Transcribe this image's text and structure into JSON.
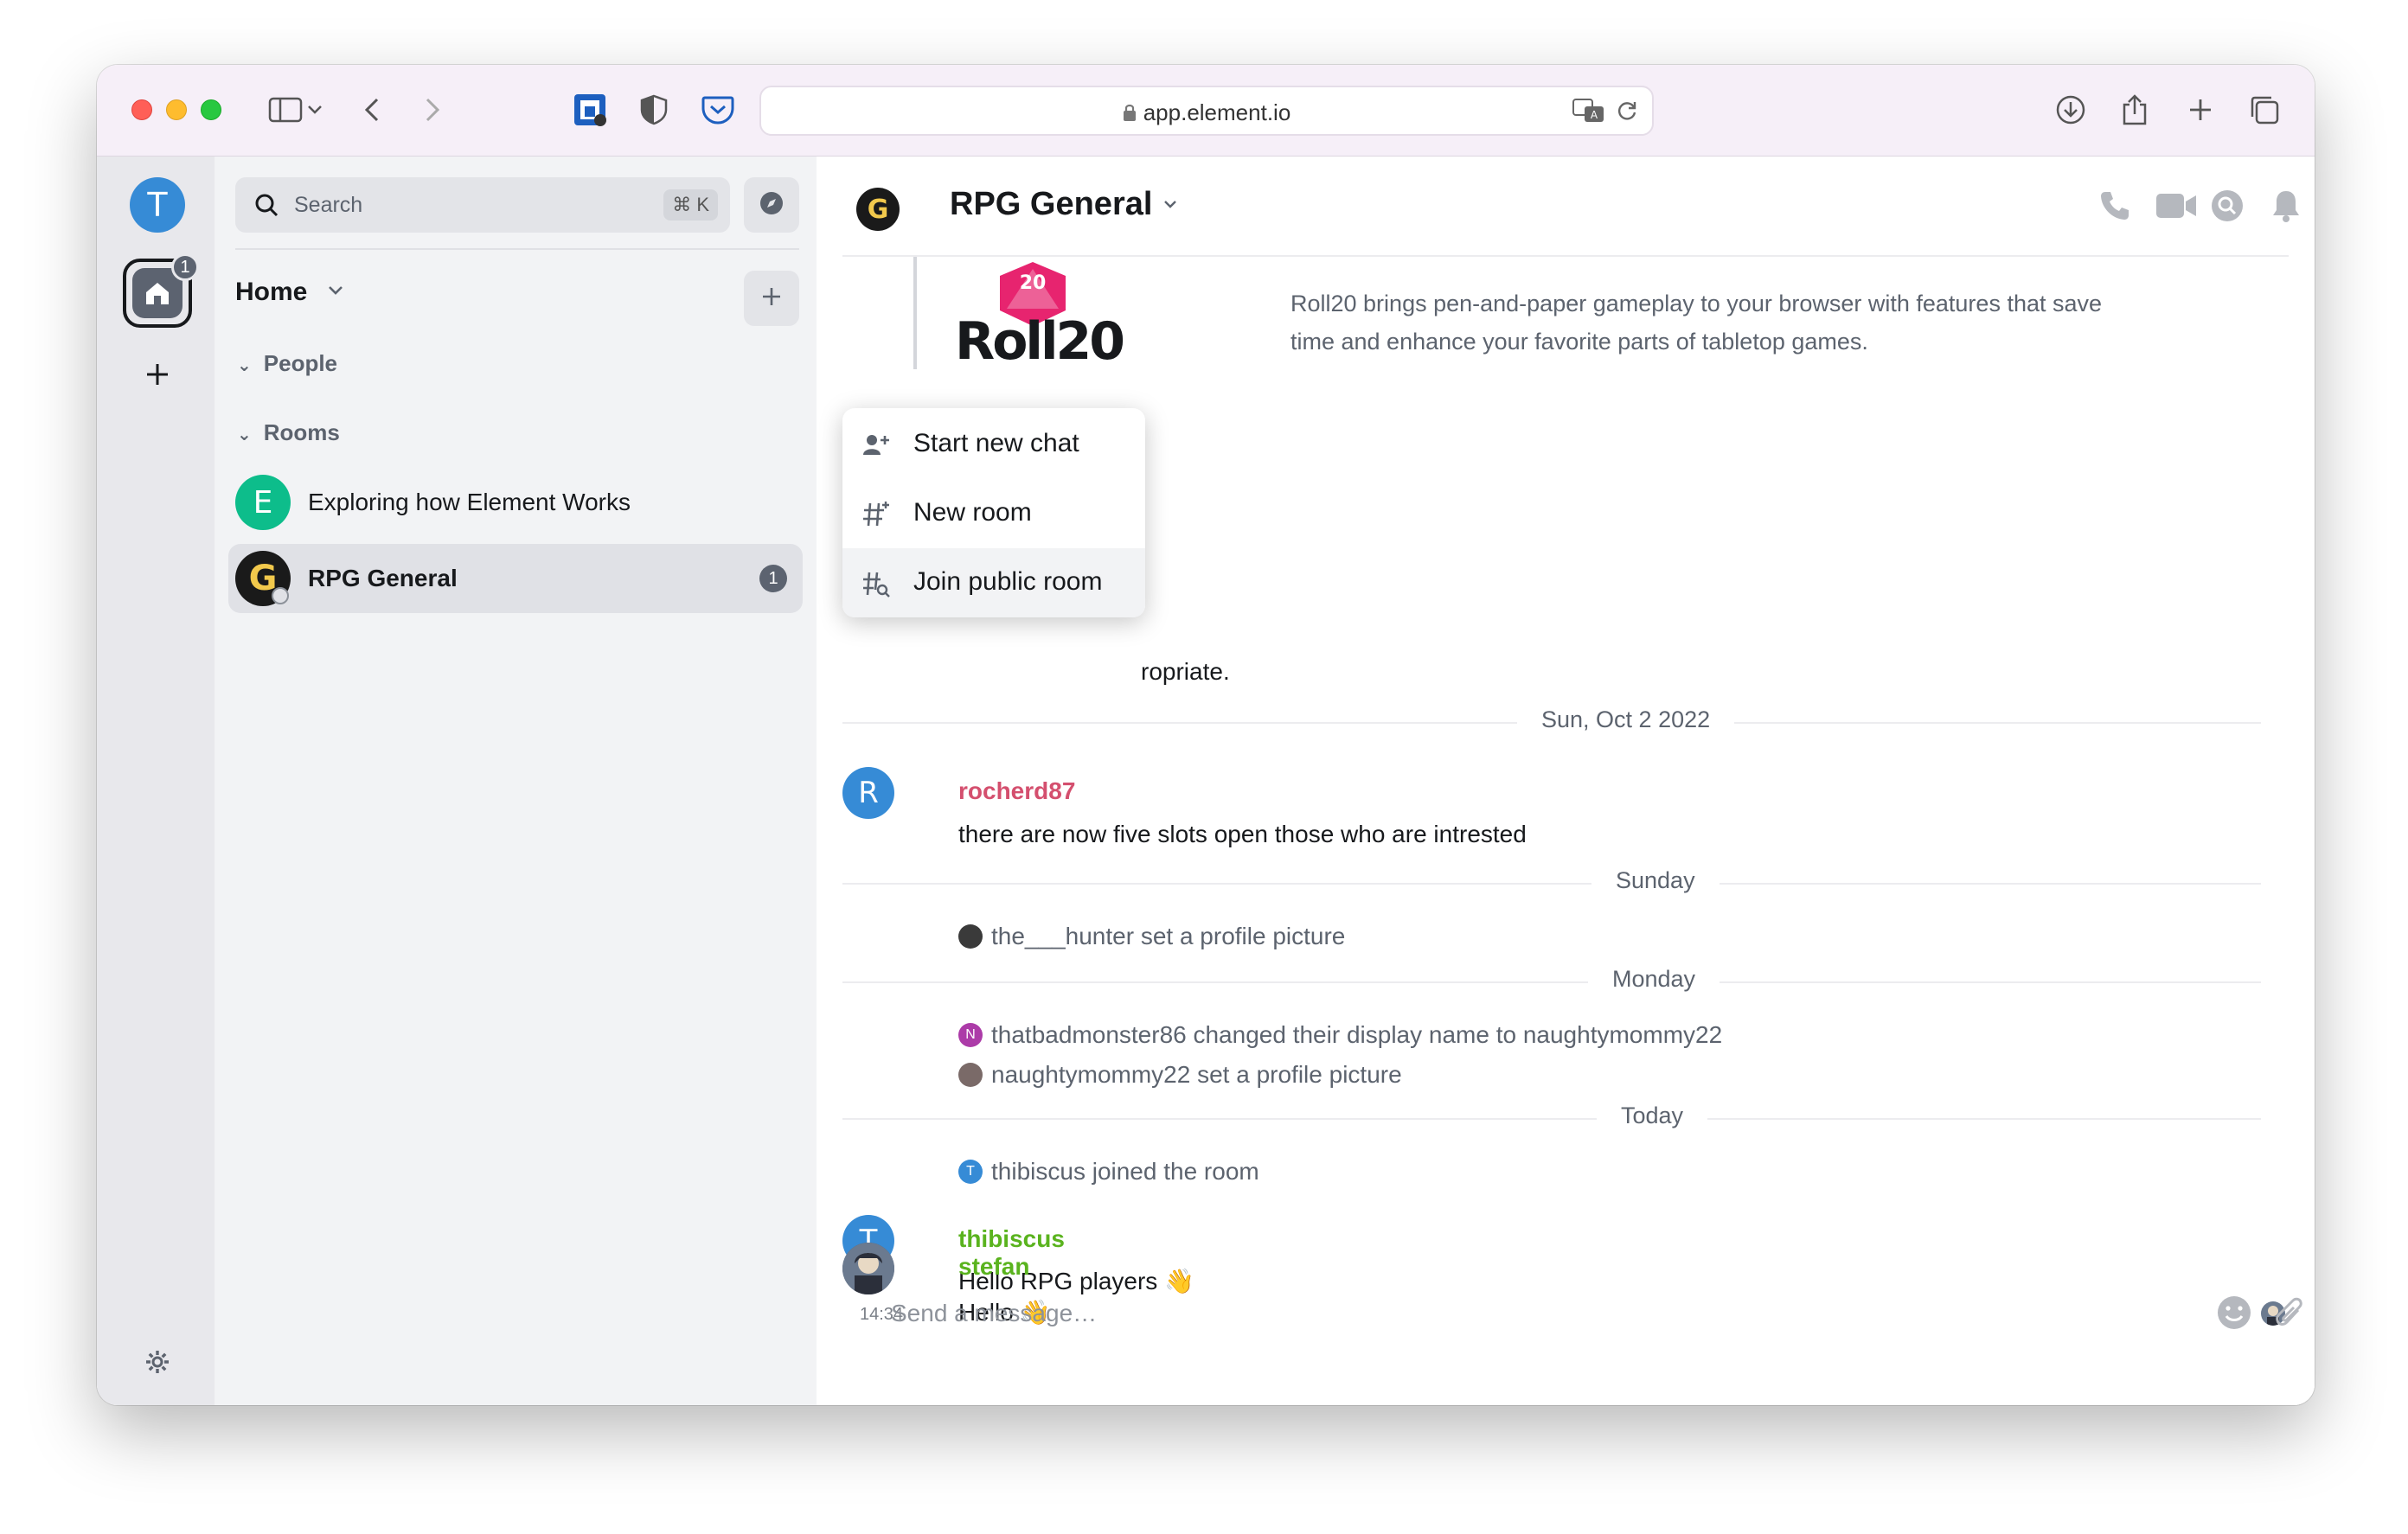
{
  "browser": {
    "url": "app.element.io"
  },
  "spaces": {
    "user_initial": "T",
    "home_badge": "1"
  },
  "roomlist": {
    "search_placeholder": "Search",
    "search_shortcut": "⌘ K",
    "home_title": "Home",
    "sections": [
      {
        "label": "People"
      },
      {
        "label": "Rooms",
        "badge": "1"
      }
    ],
    "rooms": [
      {
        "name": "Exploring how Element Works",
        "initial": "E"
      },
      {
        "name": "RPG General",
        "initial": "G",
        "badge": "1"
      }
    ]
  },
  "menu": {
    "items": [
      {
        "label": "Start new chat"
      },
      {
        "label": "New room"
      },
      {
        "label": "Join public room"
      }
    ]
  },
  "room": {
    "title": "RPG General"
  },
  "timeline": {
    "preview_logo": "Roll20",
    "preview_logo_die": "20",
    "preview_description": "Roll20 brings pen-and-paper gameplay to your browser with features that save time and enhance your favorite parts of tabletop games.",
    "truncated_text": "ropriate.",
    "dates": [
      "Sun, Oct 2 2022",
      "Sunday",
      "Monday",
      "Today"
    ],
    "messages": [
      {
        "sender": "rocherd87",
        "initial": "R",
        "body": "there are now five slots open those who are intrested",
        "color": "#d44f6e"
      },
      {
        "sender": "thibiscus",
        "initial": "T",
        "body": "Hello RPG players 👋",
        "color": "#5ab31e"
      },
      {
        "sender": "stefan",
        "body": "Hello 👋",
        "color": "#5ab31e",
        "timestamp": "14:34"
      }
    ],
    "events": [
      "the___hunter set a profile picture",
      "thatbadmonster86 changed their display name to naughtymommy22",
      "naughtymommy22 set a profile picture",
      "thibiscus joined the room"
    ],
    "event_avatar_initials": {
      "thatbadmonster86": "N",
      "thibiscus": "T"
    }
  },
  "composer": {
    "placeholder": "Send a message…"
  },
  "colors": {
    "accent": "#0dbd8b",
    "avatar_blue": "#368bd6",
    "avatar_green": "#0dbd8b",
    "avatar_purple": "#ac3ba8"
  }
}
